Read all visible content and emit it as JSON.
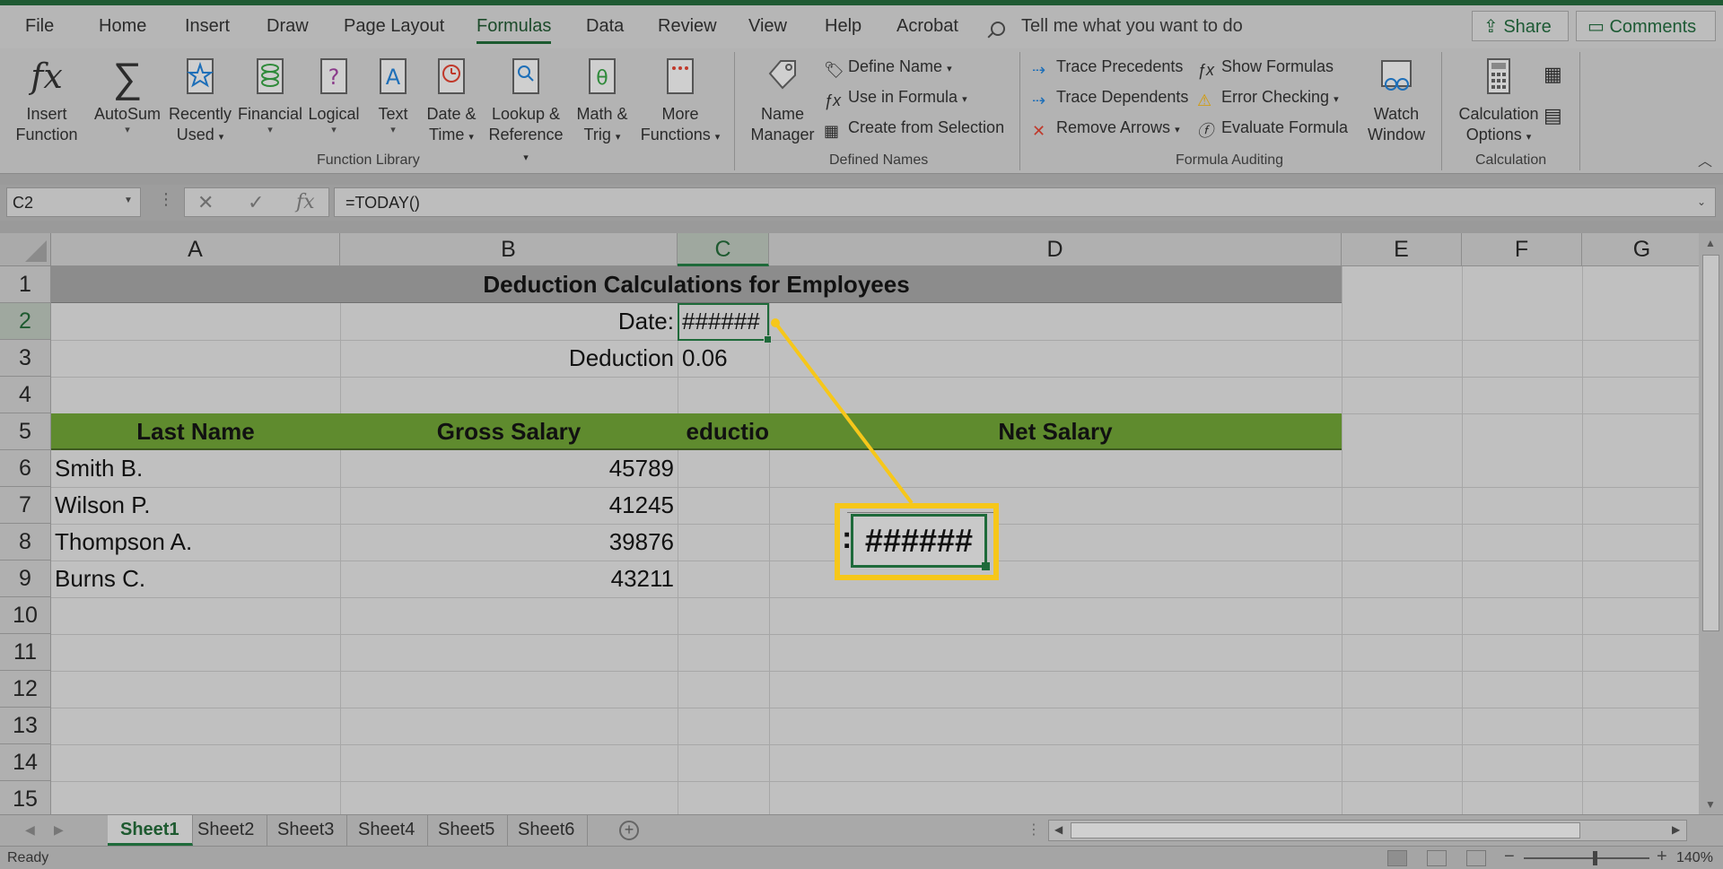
{
  "menu": {
    "tabs": [
      "File",
      "Home",
      "Insert",
      "Draw",
      "Page Layout",
      "Formulas",
      "Data",
      "Review",
      "View",
      "Help",
      "Acrobat"
    ],
    "active_tab": "Formulas",
    "tell_me": "Tell me what you want to do",
    "share": "Share",
    "comments": "Comments"
  },
  "ribbon": {
    "insert_function": [
      "Insert",
      "Function"
    ],
    "autosum": "AutoSum",
    "recently_used": [
      "Recently",
      "Used"
    ],
    "financial": "Financial",
    "logical": "Logical",
    "text": "Text",
    "date_time": [
      "Date &",
      "Time"
    ],
    "lookup_ref": [
      "Lookup &",
      "Reference"
    ],
    "math_trig": [
      "Math &",
      "Trig"
    ],
    "more_functions": [
      "More",
      "Functions"
    ],
    "function_library": "Function Library",
    "name_manager": [
      "Name",
      "Manager"
    ],
    "define_name": "Define Name",
    "use_in_formula": "Use in Formula",
    "create_from_selection": "Create from Selection",
    "defined_names": "Defined Names",
    "trace_precedents": "Trace Precedents",
    "trace_dependents": "Trace Dependents",
    "remove_arrows": "Remove Arrows",
    "show_formulas": "Show Formulas",
    "error_checking": "Error Checking",
    "evaluate_formula": "Evaluate Formula",
    "watch_window": [
      "Watch",
      "Window"
    ],
    "formula_auditing": "Formula Auditing",
    "calc_options": [
      "Calculation",
      "Options"
    ],
    "calculation": "Calculation",
    "icon_colors": {
      "function": "#2b2b2b",
      "star": "#1e6fb8",
      "financial": "#2f8a3a",
      "logical": "#8a3a8a",
      "text": "#1e6fb8",
      "date": "#c0392b",
      "lookup": "#1e6fb8",
      "math": "#2f8a3a",
      "more": "#c0392b"
    }
  },
  "formula_bar": {
    "name_box": "C2",
    "cancel_icon": "✕",
    "enter_icon": "✓",
    "fx_label": "fx",
    "formula": "=TODAY()"
  },
  "grid": {
    "columns": [
      "A",
      "B",
      "C",
      "D",
      "E",
      "F",
      "G"
    ],
    "selected_column": "C",
    "rows": [
      "1",
      "2",
      "3",
      "4",
      "5",
      "6",
      "7",
      "8",
      "9",
      "10",
      "11",
      "12",
      "13",
      "14",
      "15"
    ],
    "selected_row": "2",
    "title": "Deduction Calculations for Employees",
    "date_label": "Date:",
    "date_value": "######",
    "deduction_label": "Deduction",
    "deduction_value": "0.06",
    "headers": {
      "last_name": "Last Name",
      "gross_salary": "Gross Salary",
      "deduction": "eductio",
      "net_salary": "Net Salary"
    },
    "employees": [
      {
        "name": "Smith B.",
        "gross": "45789"
      },
      {
        "name": "Wilson P.",
        "gross": "41245"
      },
      {
        "name": "Thompson A.",
        "gross": "39876"
      },
      {
        "name": "Burns C.",
        "gross": "43211"
      }
    ],
    "header_color": "#5f8b2e",
    "title_band_color": "#8c8c8c"
  },
  "callout": {
    "colon": ":",
    "value": "######",
    "color": "#f6c71a"
  },
  "sheets": {
    "tabs": [
      "Sheet1",
      "Sheet2",
      "Sheet3",
      "Sheet4",
      "Sheet5",
      "Sheet6"
    ],
    "active": "Sheet1"
  },
  "status": {
    "text": "Ready",
    "zoom": "140%"
  }
}
